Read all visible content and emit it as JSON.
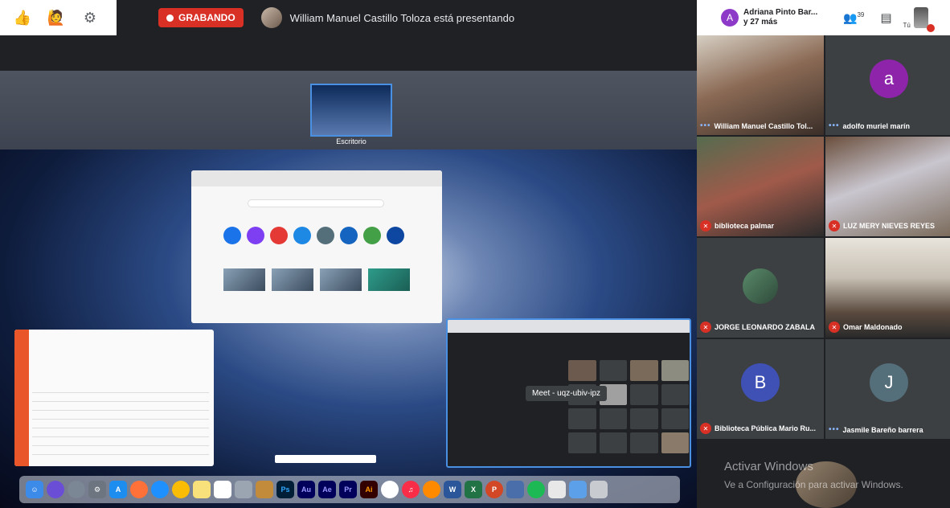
{
  "toolbar": {
    "thumbs_icon": "thumbs-up-icon",
    "emoji_icon": "raised-hand-icon",
    "settings_icon": "gear-icon"
  },
  "presenting": {
    "recording_label": "GRABANDO",
    "presenter_text": "William Manuel Castillo Toloza está presentando"
  },
  "right_header": {
    "avatar_letter": "A",
    "name_line1": "Adriana Pinto Bar...",
    "name_line2": "y 27 más",
    "people_count": "39",
    "you_label": "Tú"
  },
  "shared_screen": {
    "space_label": "Escritorio",
    "meet_tooltip": "Meet - uqz-ubiv-ipz",
    "dock_apps": [
      "Finder",
      "Siri",
      "Launchpad",
      "Preferencias",
      "App Store",
      "Firefox",
      "Safari",
      "Chrome",
      "Notas",
      "Listas",
      "Mail",
      "Vista",
      "Ps",
      "Au",
      "Ae",
      "Pr",
      "Ai",
      "Fotos",
      "Música",
      "Libros",
      "W",
      "X",
      "P",
      "Calendario",
      "Spotify",
      "Archivo",
      "Carpeta",
      "Papelera"
    ]
  },
  "participants": [
    {
      "name": "William Manuel Castillo Tol...",
      "status": "speaking"
    },
    {
      "name": "adolfo muriel marín",
      "status": "speaking",
      "initial": "a"
    },
    {
      "name": "biblioteca palmar",
      "status": "muted"
    },
    {
      "name": "LUZ MERY NIEVES REYES",
      "status": "muted"
    },
    {
      "name": "JORGE LEONARDO ZABALA",
      "status": "muted"
    },
    {
      "name": "Omar Maldonado",
      "status": "muted"
    },
    {
      "name": "Biblioteca Pública Mario Ru...",
      "status": "muted",
      "initial": "B"
    },
    {
      "name": "Jasmile Bareño barrera",
      "status": "speaking",
      "initial": "J"
    }
  ],
  "watermark": {
    "title": "Activar Windows",
    "subtitle": "Ve a Configuración para activar Windows."
  },
  "colors": {
    "recording": "#d93025",
    "avatar_a": "#8e24aa",
    "avatar_b": "#3f51b5",
    "avatar_j": "#546e7a"
  }
}
